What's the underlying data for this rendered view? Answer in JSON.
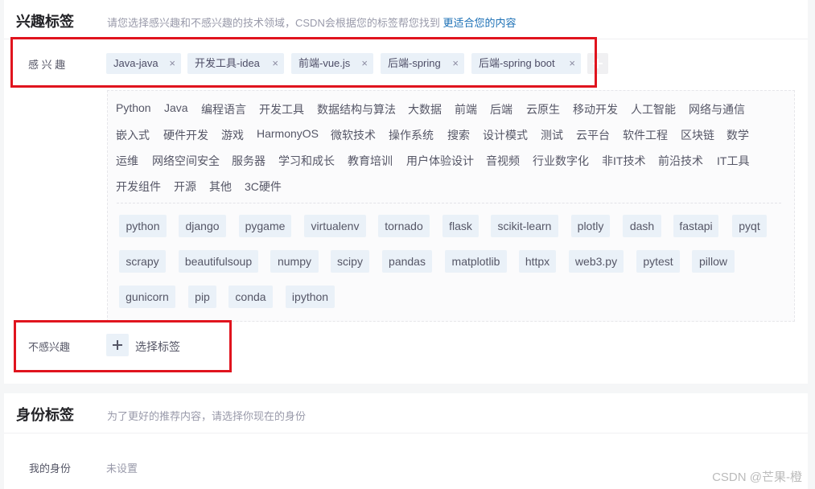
{
  "interest": {
    "title": "兴趣标签",
    "desc": "请您选择感兴趣和不感兴趣的技术领域，CSDN会根据您的标签帮您找到",
    "desc_link": "更适合您的内容",
    "interested_label": "感 兴 趣",
    "selected_tags": [
      "Java-java",
      "开发工具-idea",
      "前端-vue.js",
      "后端-spring",
      "后端-spring boot"
    ],
    "remove_glyph": "×",
    "categories": [
      "Python",
      "Java",
      "编程语言",
      "开发工具",
      "数据结构与算法",
      "大数据",
      "前端",
      "后端",
      "云原生",
      "移动开发",
      "人工智能",
      "网络与通信",
      "嵌入式",
      "硬件开发",
      "游戏",
      "HarmonyOS",
      "微软技术",
      "操作系统",
      "搜索",
      "设计模式",
      "测试",
      "云平台",
      "软件工程",
      "区块链",
      "数学",
      "运维",
      "网络空间安全",
      "服务器",
      "学习和成长",
      "教育培训",
      "用户体验设计",
      "音视频",
      "行业数字化",
      "非IT技术",
      "前沿技术",
      "IT工具",
      "开发组件",
      "开源",
      "其他",
      "3C硬件"
    ],
    "subtags": [
      "python",
      "django",
      "pygame",
      "virtualenv",
      "tornado",
      "flask",
      "scikit-learn",
      "plotly",
      "dash",
      "fastapi",
      "pyqt",
      "scrapy",
      "beautifulsoup",
      "numpy",
      "scipy",
      "pandas",
      "matplotlib",
      "httpx",
      "web3.py",
      "pytest",
      "pillow",
      "gunicorn",
      "pip",
      "conda",
      "ipython"
    ],
    "not_interested_label": "不感兴趣",
    "select_tags_label": "选择标签"
  },
  "identity": {
    "title": "身份标签",
    "desc": "为了更好的推荐内容，请选择你现在的身份",
    "my_identity_label": "我的身份",
    "my_identity_value": "未设置"
  },
  "watermark": "CSDN @芒果-橙",
  "colors": {
    "tag_bg": "#eaf1f8",
    "link": "#1a6fb5",
    "highlight_box": "#e0141e"
  }
}
